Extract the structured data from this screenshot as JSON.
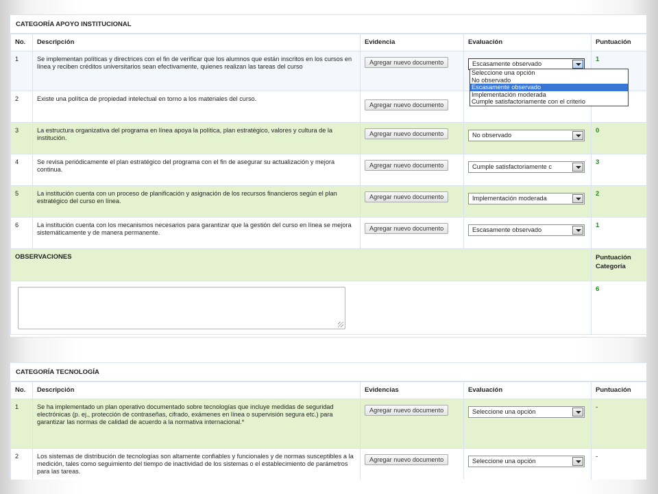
{
  "category1": {
    "title": "CATEGORÍA APOYO INSTITUCIONAL",
    "headers": {
      "no": "No.",
      "desc": "Descripción",
      "evid": "Evidencia",
      "eval": "Evaluación",
      "score": "Puntuación"
    },
    "button_label": "Agregar nuevo documento",
    "rows": [
      {
        "no": "1",
        "desc": "Se implementan políticas y directrices con el fin de verificar que los alumnos que están inscritos en los cursos en línea y reciben créditos universitarios sean efectivamente, quienes realizan las tareas del curso",
        "eval": "Escasamente observado",
        "score": "1"
      },
      {
        "no": "2",
        "desc": "Existe una política de propiedad intelectual en torno a los materiales del curso.",
        "eval": "",
        "score": ""
      },
      {
        "no": "3",
        "desc": "La estructura organizativa del programa en línea apoya la política, plan estratégico, valores y cultura de la institución.",
        "eval": "No observado",
        "score": "0"
      },
      {
        "no": "4",
        "desc": "Se revisa periódicamente el plan estratégico del programa con el fin de asegurar su actualización y mejora continua.",
        "eval": "Cumple satisfactoriamente c",
        "score": "3"
      },
      {
        "no": "5",
        "desc": "La institución cuenta con un proceso de planificación y asignación de los recursos financieros según el plan estratégico del curso en línea.",
        "eval": "Implementación moderada",
        "score": "2"
      },
      {
        "no": "6",
        "desc": "La institución cuenta con los mecanismos necesarios para garantizar que la gestión del curso en línea se mejora sistemáticamente y de manera permanente.",
        "eval": "Escasamente observado",
        "score": "1"
      }
    ],
    "dropdown_options": [
      "Seleccione una opción",
      "No observado",
      "Escasamente observado",
      "Implementación moderada",
      "Cumple satisfactoriamente con el criterio"
    ],
    "dropdown_selected": "Escasamente observado",
    "observations_label": "OBSERVACIONES",
    "category_score_label": "Puntuación Categoría",
    "category_score": "6"
  },
  "category2": {
    "title": "CATEGORÍA TECNOLOGÍA",
    "headers": {
      "no": "No.",
      "desc": "Descripción",
      "evid": "Evidencias",
      "eval": "Evaluación",
      "score": "Puntuación"
    },
    "button_label": "Agregar nuevo documento",
    "rows": [
      {
        "no": "1",
        "desc": "Se ha implementado un plan operativo documentado sobre tecnologías que incluye medidas de seguridad electrónicas (p. ej., protección de contraseñas, cifrado, exámenes en línea o supervisión segura etc.) para garantizar las normas de calidad de acuerdo a la normativa internacional.*",
        "eval": "Seleccione una opción",
        "score": "-"
      },
      {
        "no": "2",
        "desc": "Los sistemas de distribución de tecnologías son altamente confiables y funcionales y de normas susceptibles a la medición, tales como seguimiento del tiempo de inactividad de los sistemas o el establecimiento de parámetros para las tareas.",
        "eval": "Seleccione una opción",
        "score": "-"
      }
    ]
  }
}
